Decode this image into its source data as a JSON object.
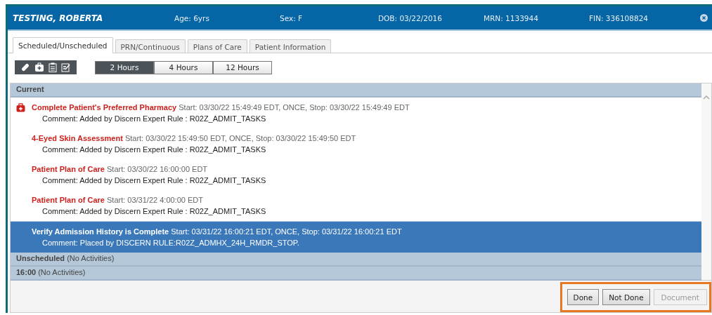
{
  "patient": {
    "name": "TESTING, ROBERTA",
    "fields": [
      "Age: 6yrs",
      "Sex: F",
      "DOB: 03/22/2016",
      "MRN: 1133944",
      "FIN: 336108824"
    ]
  },
  "tabs": [
    {
      "label": "Scheduled/Unscheduled",
      "selected": true
    },
    {
      "label": "PRN/Continuous",
      "selected": false
    },
    {
      "label": "Plans of Care",
      "selected": false
    },
    {
      "label": "Patient Information",
      "selected": false
    }
  ],
  "time_ranges": [
    {
      "label": "2 Hours",
      "selected": true
    },
    {
      "label": "4 Hours",
      "selected": false
    },
    {
      "label": "12 Hours",
      "selected": false
    }
  ],
  "current_header": "Current",
  "tasks": [
    {
      "kind": "medbag",
      "name": "Complete Patient's Preferred Pharmacy",
      "details": "Start: 03/30/22 15:49:49 EDT, ONCE, Stop: 03/30/22 15:49:49 EDT",
      "comment": "Comment: Added by Discern Expert Rule : R02Z_ADMIT_TASKS",
      "selected": false
    },
    {
      "kind": "plain",
      "name": "4-Eyed Skin Assessment",
      "details": "Start: 03/30/22 15:49:50 EDT, ONCE, Stop: 03/30/22 15:49:50 EDT",
      "comment": "Comment: Added by Discern Expert Rule : R02Z_ADMIT_TASKS",
      "selected": false
    },
    {
      "kind": "plain",
      "name": "Patient Plan of Care",
      "details": "Start: 03/30/22 16:00:00 EDT",
      "comment": "Comment: Added by Discern Expert Rule : R02Z_ADMIT_TASKS",
      "selected": false
    },
    {
      "kind": "plain",
      "name": "Patient Plan of Care",
      "details": "Start: 03/31/22 4:00:00 EDT",
      "comment": "Comment: Added by Discern Expert Rule : R02Z_ADMIT_TASKS",
      "selected": false
    },
    {
      "kind": "plain",
      "name": "Verify Admission History is Complete",
      "details": "Start: 03/31/22 16:00:21 EDT, ONCE, Stop: 03/31/22 16:00:21 EDT",
      "comment": "Comment: Placed by DISCERN RULE:R02Z_ADMHX_24H_RMDR_STOP.",
      "selected": true
    }
  ],
  "groups": [
    "**Unscheduled** (No Activities)",
    "**16:00** (No Activities)"
  ],
  "buttons": [
    {
      "label": "Done",
      "disabled": false
    },
    {
      "label": "Not Done",
      "disabled": false
    },
    {
      "label": "Document",
      "disabled": true
    }
  ]
}
